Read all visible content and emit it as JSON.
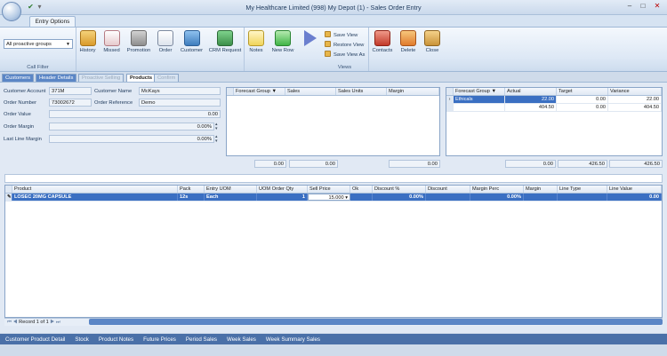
{
  "window": {
    "title": "My Healthcare Limited (998) My Depot (1) - Sales Order Entry"
  },
  "ribbon_tab": "Entry Options",
  "call_filter": {
    "selected": "All proactive groups",
    "group_label": "Call Filter"
  },
  "ribbon_buttons": {
    "history": "History",
    "missed": "Missed",
    "promotion": "Promotion",
    "order": "Order",
    "customer": "Customer",
    "crm_request": "CRM Request",
    "notes": "Notes",
    "new_row": "New Row",
    "contacts": "Contacts",
    "delete": "Delete",
    "close": "Close"
  },
  "views": {
    "save_view": "Save View",
    "restore_view": "Restore View",
    "save_view_as": "Save View As",
    "group_label": "Views"
  },
  "sub_tabs": [
    "Customers",
    "Header Details",
    "Proactive Selling",
    "Products",
    "Confirm"
  ],
  "header": {
    "customer_account_label": "Customer Account",
    "customer_account": "371M",
    "customer_name_label": "Customer Name",
    "customer_name": "McKays",
    "order_number_label": "Order Number",
    "order_number": "73002672",
    "order_reference_label": "Order Reference",
    "order_reference": "Demo",
    "order_value_label": "Order Value",
    "order_value": "0.00",
    "order_margin_label": "Order Margin",
    "order_margin": "0.00%",
    "last_line_margin_label": "Last Line Margin",
    "last_line_margin": "0.00%"
  },
  "forecast_grid": {
    "columns": [
      "Forecast Group",
      "Sales",
      "Sales Units",
      "Margin"
    ],
    "totals": [
      "0.00",
      "0.00",
      "0.00"
    ]
  },
  "target_grid": {
    "columns": [
      "Forecast Group",
      "Actual",
      "Target",
      "Variance"
    ],
    "rows": [
      [
        "Ethicals",
        "22.00",
        "0.00",
        "22.00"
      ],
      [
        "",
        "404.50",
        "0.00",
        "404.50"
      ]
    ],
    "totals": [
      "0.00",
      "426.50",
      "426.50"
    ]
  },
  "product_grid": {
    "columns": [
      "Product",
      "Pack",
      "Entry UOM",
      "UOM Order Qty",
      "Sell Price",
      "Ok",
      "Discount %",
      "Discount",
      "Margin Perc",
      "Margin",
      "Line Type",
      "Line Value"
    ],
    "rows": [
      [
        "LOSEC 20MG CAPSULE",
        "12s",
        "Each",
        "1",
        "15.000",
        "",
        "0.00%",
        "",
        "0.00%",
        "",
        "",
        "0.00"
      ]
    ]
  },
  "navigator": {
    "record_text": "Record 1 of 1"
  },
  "bottom_tabs": [
    "Customer Product Detail",
    "Stock",
    "Product Notes",
    "Future Prices",
    "Period Sales",
    "Week Sales",
    "Week Summary Sales"
  ]
}
